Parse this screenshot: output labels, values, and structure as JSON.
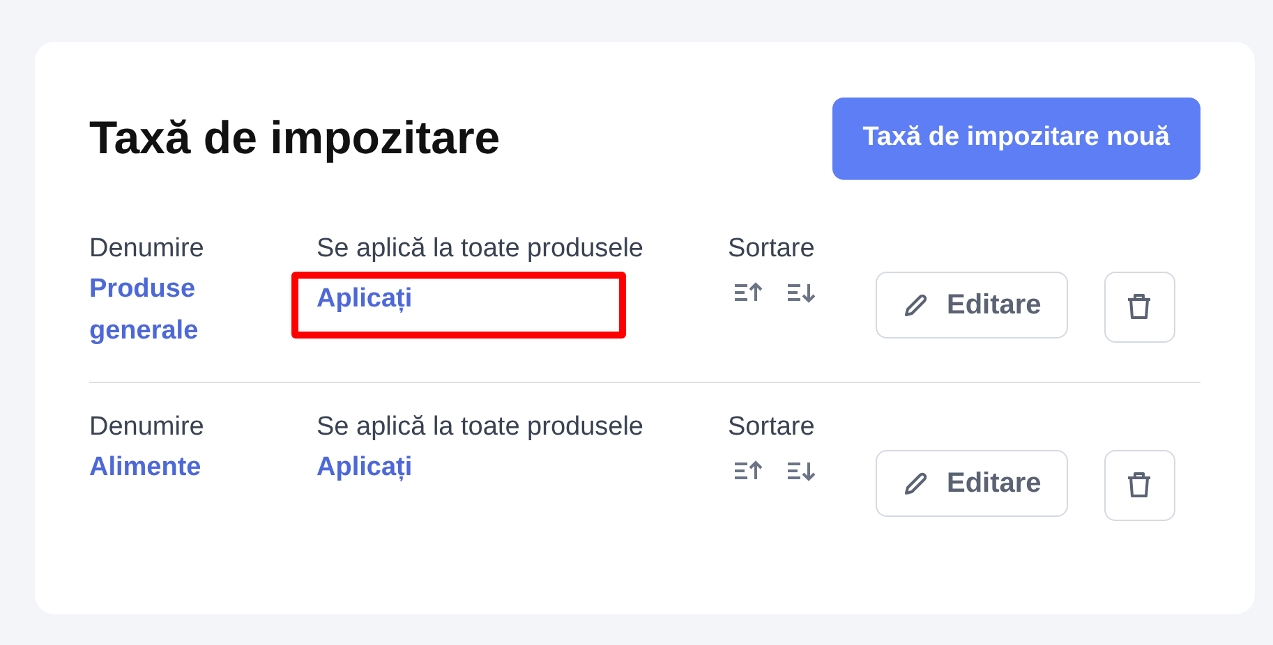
{
  "title": "Taxă de impozitare",
  "new_button": "Taxă de impozitare nouă",
  "rows": [
    {
      "name_label": "Denumire",
      "name": "Produse generale",
      "apply_label": "Se aplică la toate produsele",
      "apply": "Aplicați",
      "apply_highlighted": true,
      "sort_label": "Sortare",
      "edit": "Editare"
    },
    {
      "name_label": "Denumire",
      "name": "Alimente",
      "apply_label": "Se aplică la toate produsele",
      "apply": "Aplicați",
      "apply_highlighted": false,
      "sort_label": "Sortare",
      "edit": "Editare"
    }
  ]
}
